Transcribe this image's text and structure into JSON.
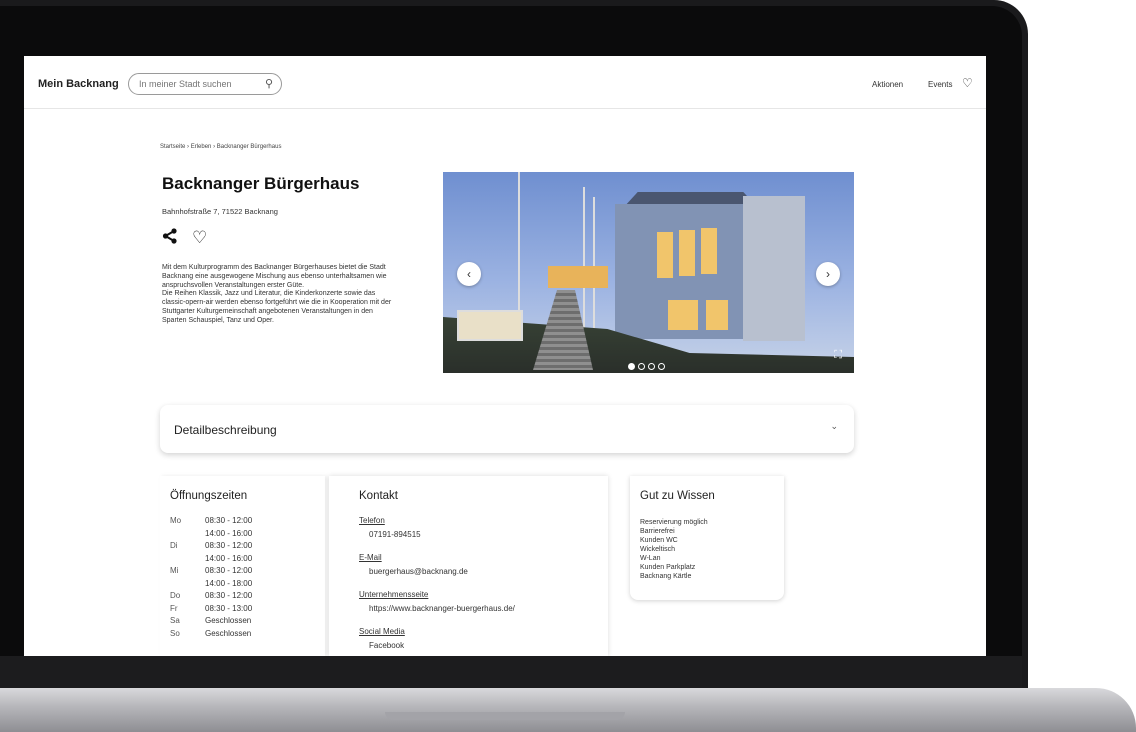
{
  "header": {
    "logo": "Mein Backnang",
    "search_placeholder": "In meiner Stadt suchen",
    "nav_aktionen": "Aktionen",
    "nav_events": "Events"
  },
  "breadcrumb": [
    "Startseite",
    "Erleben",
    "Backnanger Bürgerhaus"
  ],
  "venue": {
    "title": "Backnanger Bürgerhaus",
    "address": "Bahnhofstraße 7, 71522 Backnang",
    "description": "Mit dem Kulturprogramm des Backnanger Bürgerhauses bietet die Stadt Backnang eine ausgewogene Mischung aus ebenso unterhaltsamen wie\nanspruchsvollen Veranstaltungen erster Güte.\nDie Reihen Klassik, Jazz und Literatur, die Kinderkonzerte sowie das classic-opern-air werden ebenso fortgeführt wie die in Kooperation mit der Stuttgarter Kulturgemeinschaft angebotenen Veranstaltungen in den Sparten Schauspiel, Tanz und Oper."
  },
  "gallery": {
    "current_slide": 1,
    "total_slides": 4
  },
  "accordion": {
    "label": "Detailbeschreibung"
  },
  "opening_hours": {
    "title": "Öffnungszeiten",
    "rows": [
      {
        "day": "Mo",
        "lines": [
          "08:30 - 12:00",
          "14:00 - 16:00"
        ]
      },
      {
        "day": "Di",
        "lines": [
          "08:30 - 12:00",
          "14:00 - 16:00"
        ]
      },
      {
        "day": "Mi",
        "lines": [
          "08:30 - 12:00",
          "14:00 - 18:00"
        ]
      },
      {
        "day": "Do",
        "lines": [
          "08:30 - 12:00"
        ]
      },
      {
        "day": "Fr",
        "lines": [
          "08:30 - 13:00"
        ]
      },
      {
        "day": "Sa",
        "lines": [
          "Geschlossen"
        ]
      },
      {
        "day": "So",
        "lines": [
          "Geschlossen"
        ]
      }
    ]
  },
  "contact": {
    "title": "Kontakt",
    "phone_label": "Telefon",
    "phone": "07191-894515",
    "email_label": "E-Mail",
    "email": "buergerhaus@backnang.de",
    "website_label": "Unternehmensseite",
    "website": "https://www.backnanger-buergerhaus.de/",
    "social_label": "Social Media",
    "social": "Facebook"
  },
  "good_to_know": {
    "title": "Gut zu Wissen",
    "items": [
      "Reservierung möglich",
      "Barrierefrei",
      "Kunden WC",
      "Wickeltisch",
      "W-Lan",
      "Kunden Parkplatz",
      "Backnang Kärtle"
    ]
  }
}
